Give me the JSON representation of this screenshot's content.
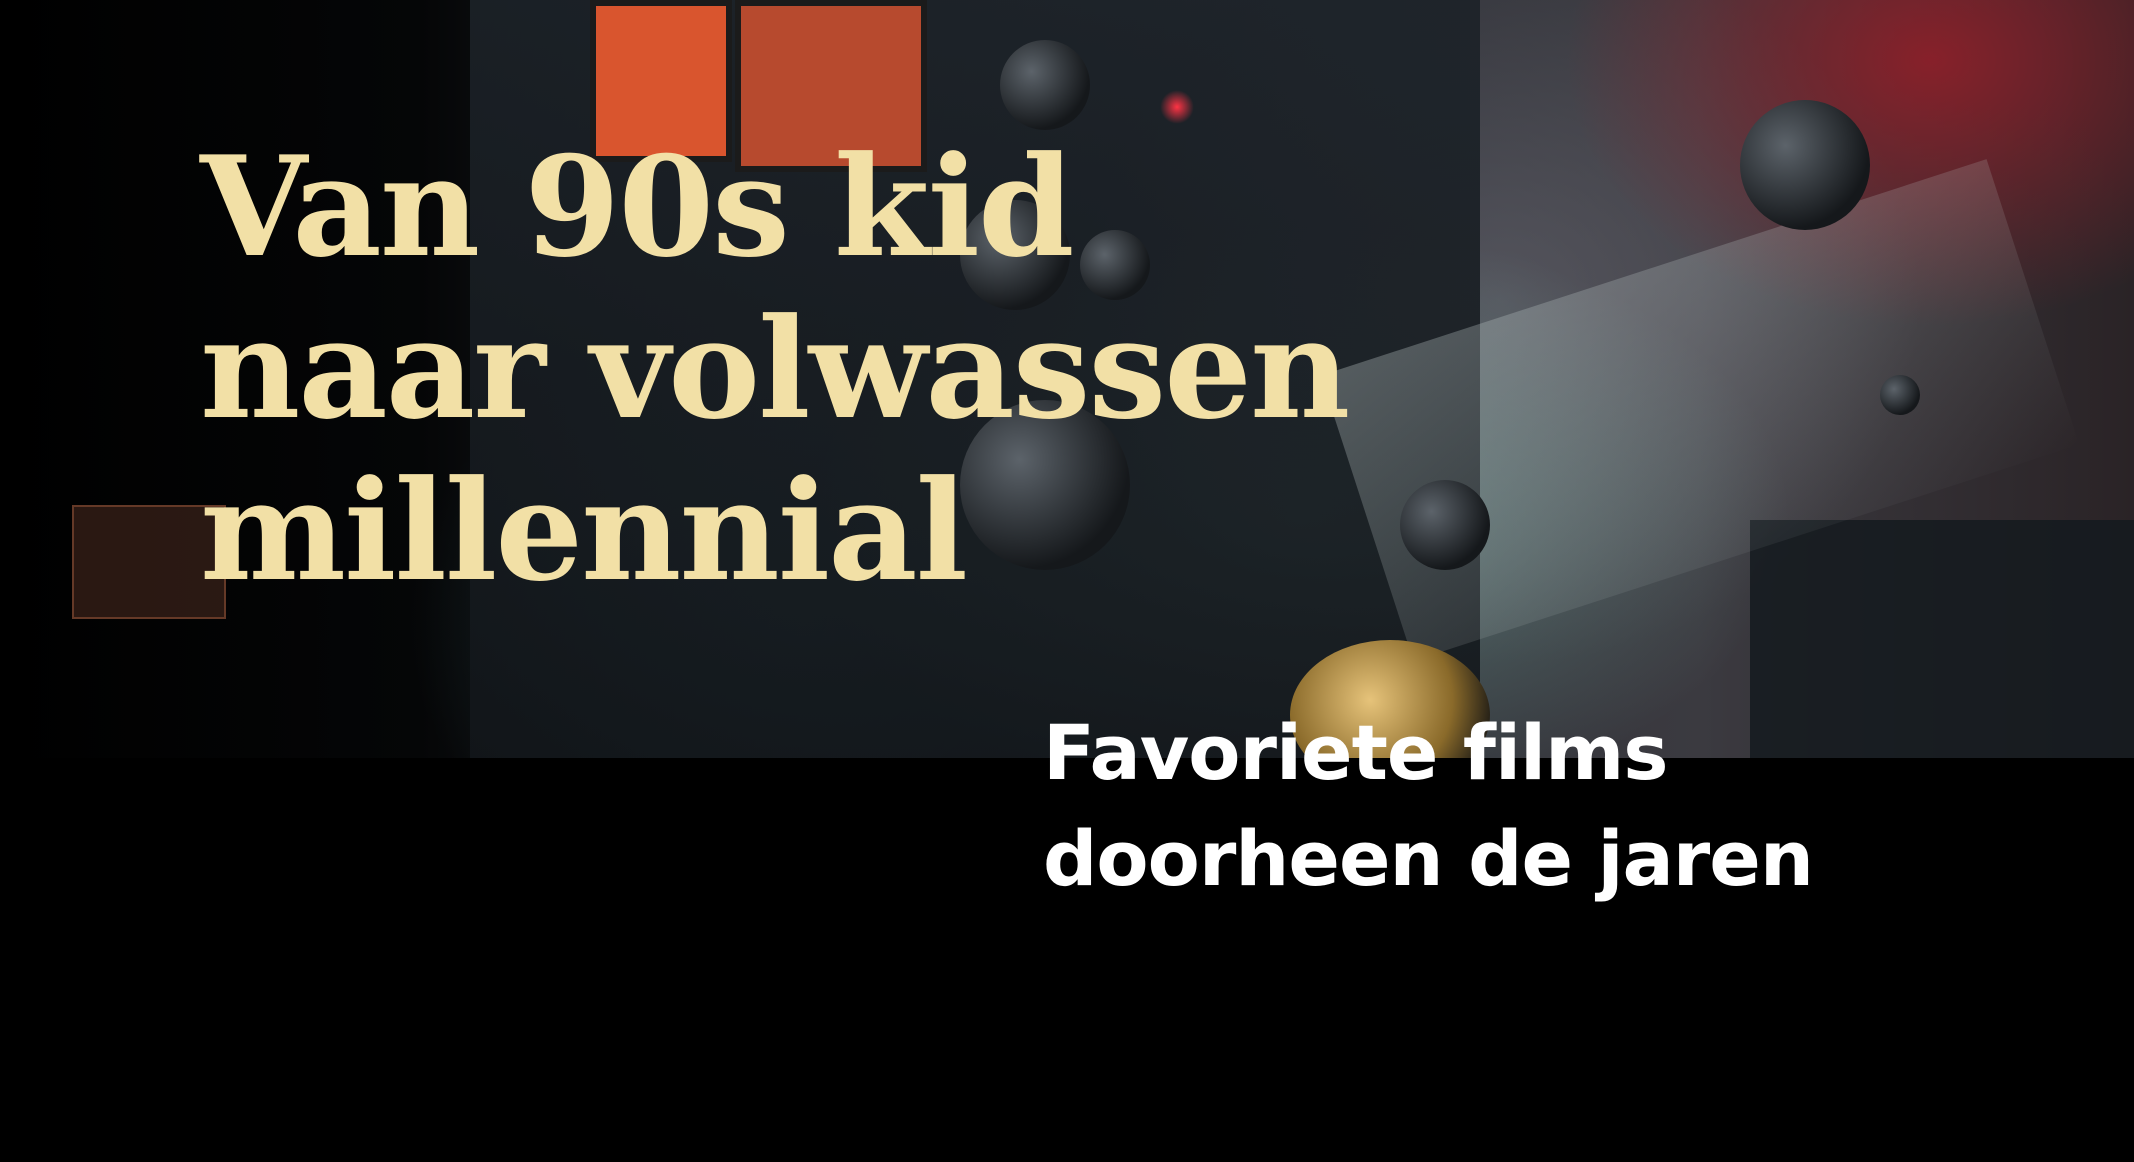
{
  "hero": {
    "image_alt_icon": "film-projector-photo",
    "headline_lines": [
      "Van 90s kid",
      "naar volwassen",
      "millennial"
    ],
    "subtitle_lines": [
      "Favoriete films",
      "doorheen de jaren"
    ]
  },
  "colors": {
    "background": "#000000",
    "headline": "#f2e0a6",
    "subtitle": "#ffffff"
  }
}
